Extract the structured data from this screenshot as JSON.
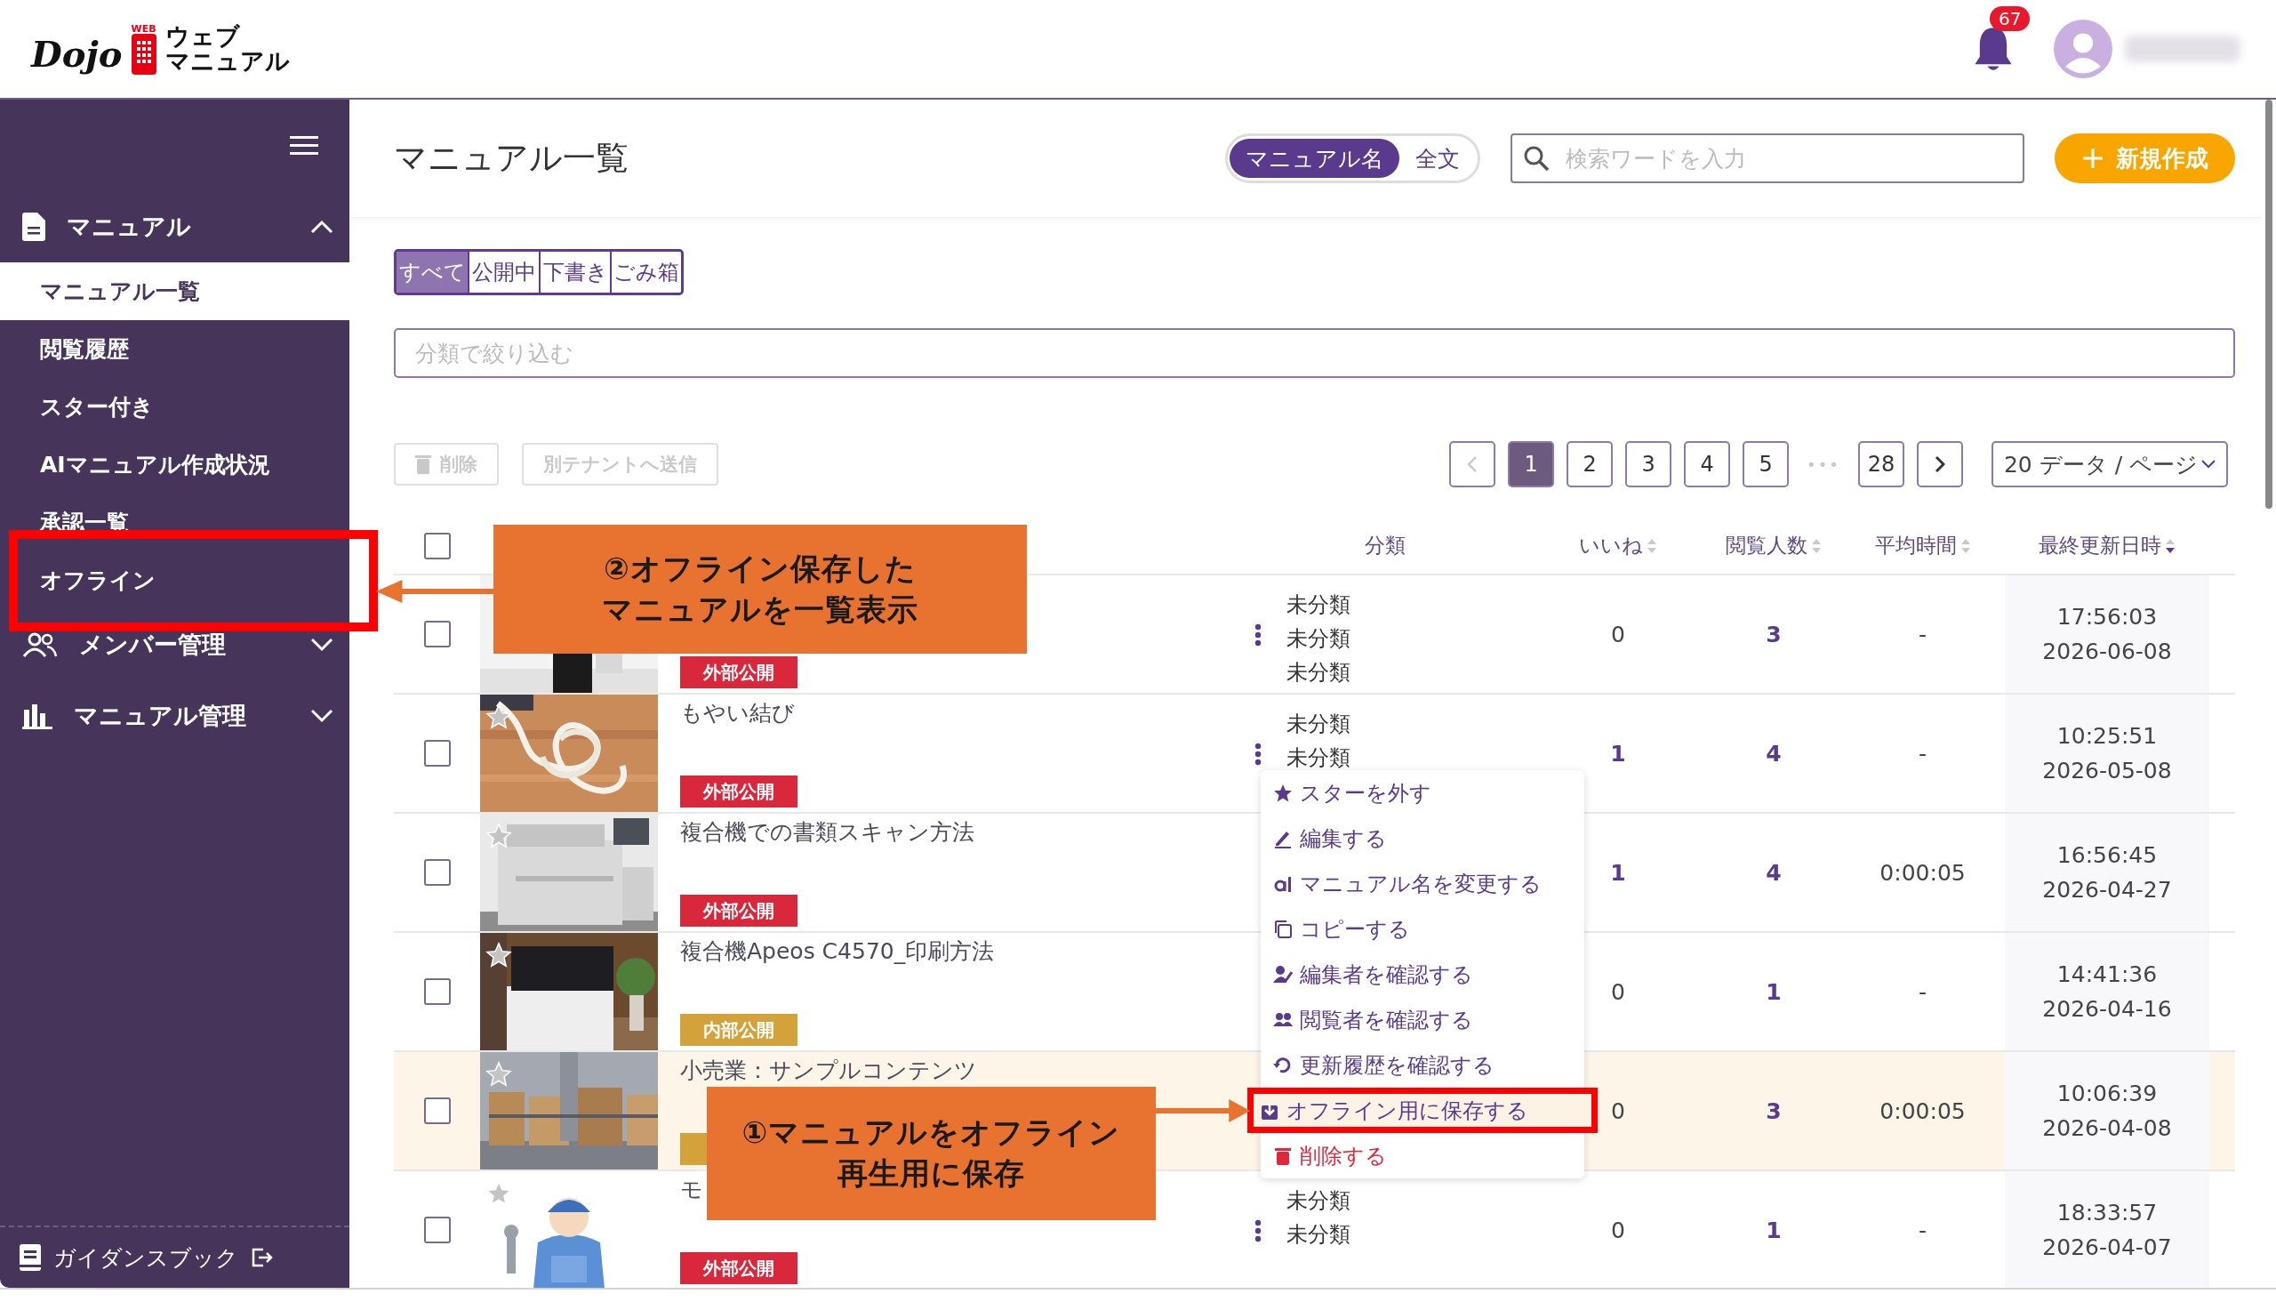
{
  "header": {
    "logo": {
      "brand": "Dojo",
      "badge": "WEB",
      "lines": [
        "ウェブ",
        "マニュアル"
      ]
    },
    "notifications": "67"
  },
  "sidebar": {
    "sections": [
      {
        "label": "マニュアル",
        "expanded": true,
        "children": [
          {
            "label": "マニュアル一覧",
            "selected": true
          },
          {
            "label": "閲覧履歴",
            "selected": false
          },
          {
            "label": "スター付き",
            "selected": false
          },
          {
            "label": "AIマニュアル作成状況",
            "selected": false
          },
          {
            "label": "承認一覧",
            "selected": false
          },
          {
            "label": "オフライン",
            "selected": false
          }
        ]
      },
      {
        "label": "メンバー管理",
        "expanded": false
      },
      {
        "label": "マニュアル管理",
        "expanded": false
      }
    ],
    "footer": "ガイダンスブック"
  },
  "page_title": "マニュアル一覧",
  "search_mode": [
    {
      "label": "マニュアル名",
      "selected": true
    },
    {
      "label": "全文",
      "selected": false
    }
  ],
  "search": {
    "placeholder": "検索ワードを入力"
  },
  "new_button": "新規作成",
  "status_tabs": [
    {
      "label": "すべて",
      "selected": true
    },
    {
      "label": "公開中",
      "selected": false
    },
    {
      "label": "下書き",
      "selected": false
    },
    {
      "label": "ごみ箱",
      "selected": false
    }
  ],
  "category_filter": {
    "placeholder": "分類で絞り込む"
  },
  "actions": [
    {
      "label": "削除",
      "disabled": true,
      "kind": "delete"
    },
    {
      "label": "別テナントへ送信",
      "disabled": true,
      "kind": "send"
    }
  ],
  "pagination": {
    "prev_disabled": true,
    "next_disabled": false,
    "pages": [
      {
        "label": "1",
        "selected": true
      },
      {
        "label": "2",
        "selected": false
      },
      {
        "label": "3",
        "selected": false
      },
      {
        "label": "4",
        "selected": false
      },
      {
        "label": "5",
        "selected": false
      }
    ],
    "ellipsis": "•••",
    "last": {
      "label": "28",
      "selected": false
    },
    "per_page": "20 データ / ページ"
  },
  "table": {
    "header_checked": false,
    "columns": [
      {
        "label": "分類",
        "sortable": false
      },
      {
        "label": "いいね",
        "sortable": true,
        "sorted": false
      },
      {
        "label": "閲覧人数",
        "sortable": true,
        "sorted": false
      },
      {
        "label": "平均時間",
        "sortable": true,
        "sorted": false
      },
      {
        "label": "最終更新日時",
        "sortable": true,
        "sorted": true
      }
    ],
    "rows": [
      {
        "checked": false,
        "highlighted": false,
        "thumbnail": {
          "kind": "picture"
        },
        "badge": {
          "kind": "external",
          "label": "外部公開"
        },
        "more": true,
        "categories": [
          "未分類",
          "未分類",
          "未分類"
        ],
        "likes": {
          "value": "0",
          "emphasized": false
        },
        "views": "3",
        "avg_time": "-",
        "time": "17:56:03",
        "date": "2026-06-08"
      },
      {
        "checked": false,
        "highlighted": false,
        "star": true,
        "thumbnail": {
          "kind": "picture"
        },
        "title": "もやい結び",
        "badge": {
          "kind": "external",
          "label": "外部公開"
        },
        "more": true,
        "categories": [
          "未分類",
          "未分類"
        ],
        "likes": {
          "value": "1",
          "emphasized": true
        },
        "views": "4",
        "avg_time": "-",
        "time": "10:25:51",
        "date": "2026-05-08"
      },
      {
        "checked": false,
        "highlighted": false,
        "star": true,
        "thumbnail": {
          "kind": "picture"
        },
        "title": "複合機での書類スキャン方法",
        "badge": {
          "kind": "external",
          "label": "外部公開"
        },
        "more": false,
        "likes": {
          "value": "1",
          "emphasized": true
        },
        "views": "4",
        "avg_time": "0:00:05",
        "time": "16:56:45",
        "date": "2026-04-27"
      },
      {
        "checked": false,
        "highlighted": false,
        "star": true,
        "thumbnail": {
          "kind": "picture"
        },
        "title": "複合機Apeos C4570_印刷方法",
        "badge": {
          "kind": "internal",
          "label": "内部公開"
        },
        "more": false,
        "likes": {
          "value": "0",
          "emphasized": false
        },
        "views": "1",
        "avg_time": "-",
        "time": "14:41:36",
        "date": "2026-04-16"
      },
      {
        "checked": false,
        "highlighted": true,
        "star": true,
        "thumbnail": {
          "kind": "picture"
        },
        "title": "小売業：サンプルコンテンツ",
        "badge": {
          "kind": "internal"
        },
        "more": false,
        "likes": {
          "value": "0",
          "emphasized": false
        },
        "views": "3",
        "avg_time": "0:00:05",
        "time": "10:06:39",
        "date": "2026-04-08"
      },
      {
        "checked": false,
        "highlighted": false,
        "star": true,
        "thumbnail": {
          "kind": "picture"
        },
        "title": "モ",
        "badge": {
          "kind": "external",
          "label": "外部公開"
        },
        "more": true,
        "categories": [
          "未分類",
          "未分類"
        ],
        "likes": {
          "value": "0",
          "emphasized": false
        },
        "views": "1",
        "avg_time": "-",
        "time": "18:33:57",
        "date": "2026-04-07"
      }
    ]
  },
  "context_menu": [
    {
      "label": "スターを外す",
      "danger": false,
      "highlighted": false
    },
    {
      "label": "編集する",
      "danger": false,
      "highlighted": false
    },
    {
      "label": "マニュアル名を変更する",
      "danger": false,
      "highlighted": false
    },
    {
      "label": "コピーする",
      "danger": false,
      "highlighted": false
    },
    {
      "label": "編集者を確認する",
      "danger": false,
      "highlighted": false
    },
    {
      "label": "閲覧者を確認する",
      "danger": false,
      "highlighted": false
    },
    {
      "label": "更新履歴を確認する",
      "danger": false,
      "highlighted": false
    },
    {
      "label": "オフライン用に保存する",
      "danger": false,
      "highlighted": true
    },
    {
      "label": "削除する",
      "danger": true,
      "highlighted": false
    }
  ],
  "annotations": [
    {
      "kind": "sidebar",
      "lines": [
        "②オフライン保存した",
        "マニュアルを一覧表示"
      ]
    },
    {
      "kind": "menu",
      "lines": [
        "①マニュアルをオフライン",
        "再生用に保存"
      ]
    }
  ]
}
